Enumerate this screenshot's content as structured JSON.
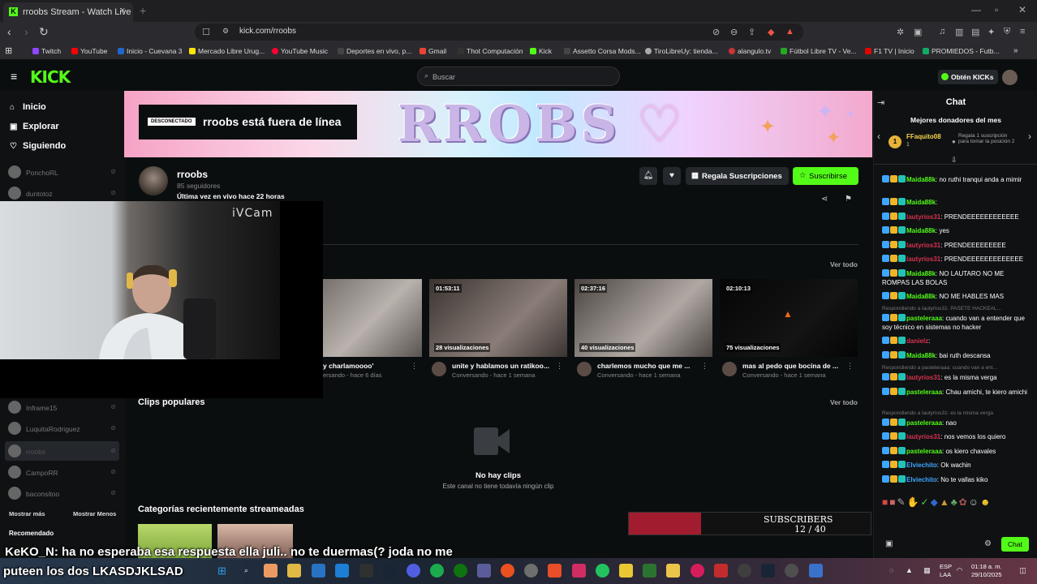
{
  "browser": {
    "tab_title": "rroobs Stream - Watch Live on K",
    "tab_close": "×",
    "new_tab": "+",
    "url": "kick.com/rroobs",
    "bookmarks": [
      "Twitch",
      "YouTube",
      "Inicio - Cuevana 3",
      "Mercado Libre Urug...",
      "YouTube Music",
      "Deportes en vivo, p...",
      "Gmail",
      "Thot Computación",
      "Kick",
      "Assetto Corsa Mods...",
      "TiroLibreUy: tienda...",
      "alangulo.tv",
      "Fútbol Libre TV - Ve...",
      "F1 TV | Inicio",
      "PROMIEDOS - Futb..."
    ]
  },
  "header": {
    "logo": "KICK",
    "search_placeholder": "Buscar",
    "get_kicks": "Obtén KICKs"
  },
  "sidebar": {
    "nav": [
      "Inicio",
      "Explorar",
      "Siguiendo"
    ],
    "channels_top": [
      "PonchoRL",
      "duntotoz"
    ],
    "channels": [
      "Inframe15",
      "LuquitaRodriguez",
      "rroobs",
      "CampoRR",
      "baconsitoo"
    ],
    "show_more": "Mostrar más",
    "show_less": "Mostrar Menos",
    "recommended": "Recomendado"
  },
  "banner": {
    "offline_badge": "DESCONECTADO",
    "offline_text": "rroobs está fuera de línea",
    "logo_text": "RROBS"
  },
  "channel": {
    "name": "rroobs",
    "followers": "85 seguidores",
    "last_live": "Última vez en vivo hace 22 horas",
    "gift_subs": "Regala Suscripciones",
    "subscribe": "Suscribirse"
  },
  "webcam": {
    "watermark": "iVCam"
  },
  "videos": {
    "see_all": "Ver todo",
    "items": [
      {
        "duration": "",
        "views": "iciones",
        "title": "y charlamoooo'",
        "meta": "ersando - hace 6 días",
        "color1": "#5a5450",
        "color2": "#b9b2ad"
      },
      {
        "duration": "01:53:11",
        "views": "28 visualizaciones",
        "title": "unite y hablamos un ratikoo...",
        "meta": "Conversando - hace 1 semana",
        "color1": "#3a3431",
        "color2": "#8a7d78"
      },
      {
        "duration": "02:37:16",
        "views": "40 visualizaciones",
        "title": "charlemos mucho que me ...",
        "meta": "Conversando - hace 1 semana",
        "color1": "#4a4542",
        "color2": "#b0a8a3"
      },
      {
        "duration": "02:10:13",
        "views": "75 visualizaciones",
        "title": "mas al pedo que bocina de ...",
        "meta": "Conversando - hace 1 semana",
        "color1": "#050505",
        "color2": "#141414"
      }
    ]
  },
  "clips": {
    "title": "Clips populares",
    "see_all": "Ver todo",
    "empty_title": "No hay clips",
    "empty_sub": "Este canal no tiene todavía ningún clip"
  },
  "categories": {
    "title": "Categorías recientemente streameadas"
  },
  "chat": {
    "title": "Chat",
    "top_donors": "Mejores donadores del mes",
    "donor_name": "FFaquito08",
    "donor_count": "1",
    "gift_tip": "Regala 1 suscripción para tomar la posición 2",
    "button": "Chat",
    "messages": [
      {
        "type": "msg",
        "user": "Maida88k",
        "color": "#53fc18",
        "text": ": no ruthi tranqui anda a mimir"
      },
      {
        "type": "msg",
        "user": "Maida88k",
        "color": "#53fc18",
        "text": ":"
      },
      {
        "type": "msg",
        "user": "lautyrios31",
        "color": "#d8324f",
        "text": ": PRENDEEEEEEEEEEEE"
      },
      {
        "type": "msg",
        "user": "Maida88k",
        "color": "#53fc18",
        "text": ": yes"
      },
      {
        "type": "msg",
        "user": "lautyrios31",
        "color": "#d8324f",
        "text": ": PRENDEEEEEEEEE"
      },
      {
        "type": "msg",
        "user": "lautyrios31",
        "color": "#d8324f",
        "text": ": PRENDEEEEEEEEEEEEE"
      },
      {
        "type": "msg",
        "user": "Maida88k",
        "color": "#53fc18",
        "text": ": NO LAUTARO NO ME ROMPAS LAS BOLAS"
      },
      {
        "type": "msg",
        "user": "Maida88k",
        "color": "#53fc18",
        "text": ": NO ME HABLES MAS"
      },
      {
        "type": "reply",
        "text": "Respondiendo a lautyrios31: PASETE HACKEAL..."
      },
      {
        "type": "msg",
        "user": "pasteleraaa",
        "color": "#53fc18",
        "text": ": cuando van a entender que soy técnico en sistemas no hacker"
      },
      {
        "type": "msg",
        "user": "danielz",
        "color": "#d8324f",
        "text": ":"
      },
      {
        "type": "msg",
        "user": "Maida88k",
        "color": "#53fc18",
        "text": ": bai ruth descansa"
      },
      {
        "type": "reply",
        "text": "Respondiendo a pasteleraaa: cuando van a ent..."
      },
      {
        "type": "msg",
        "user": "lautyrios31",
        "color": "#d8324f",
        "text": ": es la misma verga"
      },
      {
        "type": "msg",
        "user": "pasteleraaa",
        "color": "#53fc18",
        "text": ": Chau amichi, te kiero amichi"
      },
      {
        "type": "reply",
        "text": "Respondiendo a lautyrios31: es la misma verga"
      },
      {
        "type": "msg",
        "user": "pasteleraaa",
        "color": "#53fc18",
        "text": ": nao"
      },
      {
        "type": "msg",
        "user": "lautyrios31",
        "color": "#d8324f",
        "text": ": nos vemos los quiero"
      },
      {
        "type": "msg",
        "user": "pasteleraaa",
        "color": "#53fc18",
        "text": ": os kiero chavales"
      },
      {
        "type": "msg",
        "user": "Elviechito",
        "color": "#3ea6ff",
        "text": ": Ok wachin"
      },
      {
        "type": "msg",
        "user": "Elviechito",
        "color": "#3ea6ff",
        "text": ": No te vallas kiko"
      }
    ]
  },
  "sub_widget": {
    "title": "SUBSCRIBERS",
    "count": "12 / 40",
    "current": 12,
    "goal": 40
  },
  "overlay": {
    "nick": "KeKO_N",
    "line1": ": ha no esperaba esa respuesta ella juli.. no te duermas(? joda no me",
    "line2": "puteen los dos LKASDJKLSAD"
  },
  "taskbar": {
    "lang1": "ESP",
    "lang2": "LAA",
    "time": "01:18 a. m.",
    "date": "29/10/2025"
  }
}
